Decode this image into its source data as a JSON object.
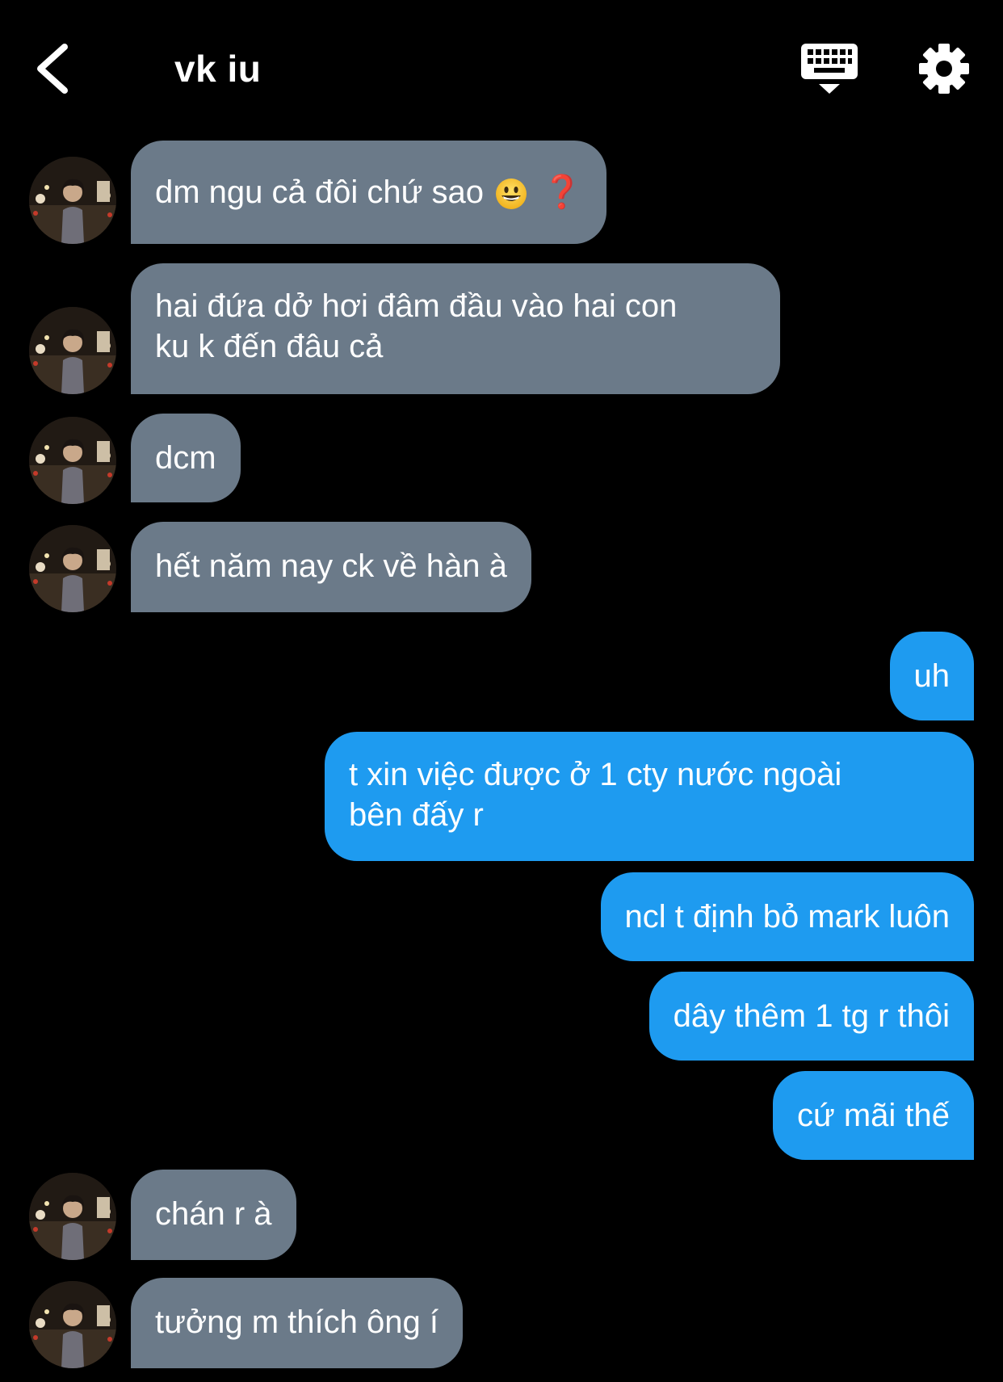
{
  "header": {
    "title": "vk iu"
  },
  "messages": {
    "m1": {
      "text": "dm ngu cả đôi chứ sao",
      "emoji": "grinning-face",
      "mark": "❓"
    },
    "m2": {
      "line1": "hai đứa dở hơi đâm đầu vào hai con",
      "line2": "ku k đến đâu cả"
    },
    "m3": {
      "text": "dcm"
    },
    "m4": {
      "text": "hết năm nay ck về hàn à"
    },
    "m5": {
      "text": "uh"
    },
    "m6": {
      "line1": "t xin việc được ở 1 cty nước ngoài",
      "line2": "bên đấy r"
    },
    "m7": {
      "text": "ncl t định bỏ mark luôn"
    },
    "m8": {
      "text": "dây thêm 1 tg r thôi"
    },
    "m9": {
      "text": "cứ mãi thế"
    },
    "m10": {
      "text": "chán r à"
    },
    "m11": {
      "text": "tưởng m thích ông í"
    }
  },
  "colors": {
    "background": "#000000",
    "incoming_bubble": "#6b7a89",
    "outgoing_bubble": "#1e9bf0",
    "text": "#ffffff"
  },
  "icons": [
    "back-chevron-icon",
    "keyboard-icon",
    "gear-icon",
    "avatar-photo"
  ]
}
